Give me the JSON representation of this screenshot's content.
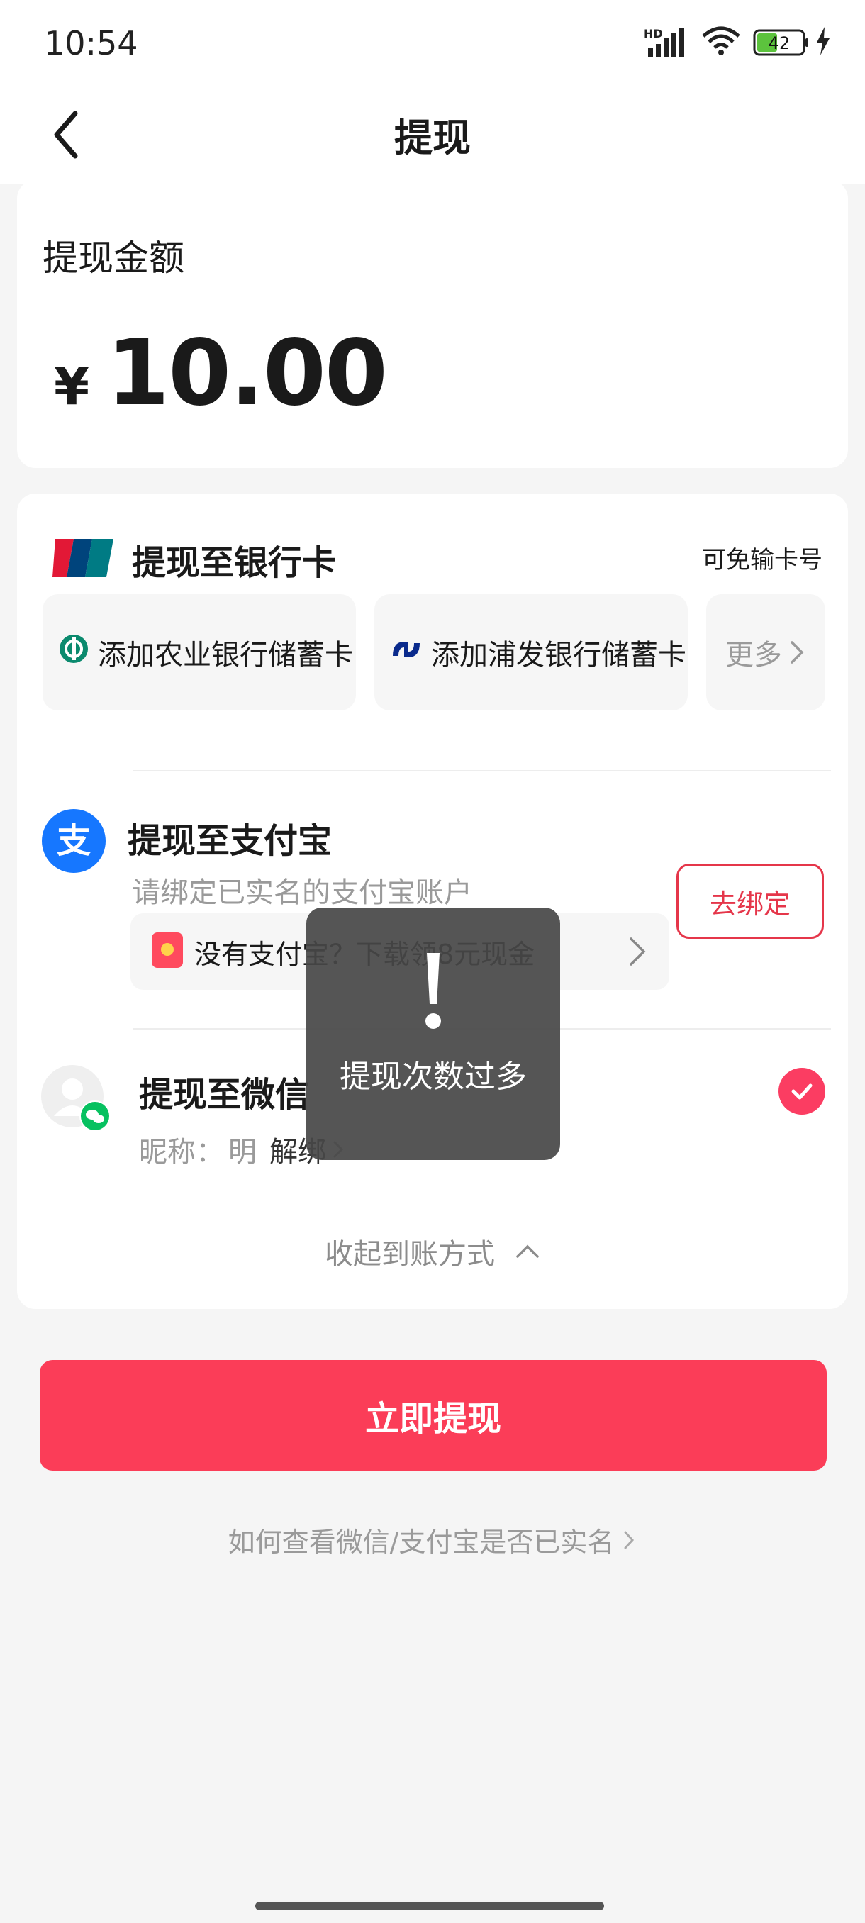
{
  "status_bar": {
    "time": "10:54",
    "battery": "42",
    "network_badge": "HD"
  },
  "nav": {
    "title": "提现"
  },
  "amount": {
    "label": "提现金额",
    "currency": "¥",
    "value": "10.00"
  },
  "bank": {
    "title": "提现至银行卡",
    "note": "可免输卡号",
    "options": [
      "添加农业银行储蓄卡",
      "添加浦发银行储蓄卡"
    ],
    "more": "更多"
  },
  "alipay": {
    "title": "提现至支付宝",
    "subtitle": "请绑定已实名的支付宝账户",
    "promo": "没有支付宝？下载领8元现金",
    "bind_button": "去绑定"
  },
  "wechat": {
    "title": "提现至微信",
    "nickname_label": "昵称：",
    "nickname": "明",
    "unbind": "解绑"
  },
  "collapse": "收起到账方式",
  "submit": "立即提现",
  "help": "如何查看微信/支付宝是否已实名",
  "toast": {
    "message": "提现次数过多"
  },
  "colors": {
    "accent": "#fb3d58",
    "alipay_blue": "#1677ff",
    "wechat_green": "#07c160"
  }
}
